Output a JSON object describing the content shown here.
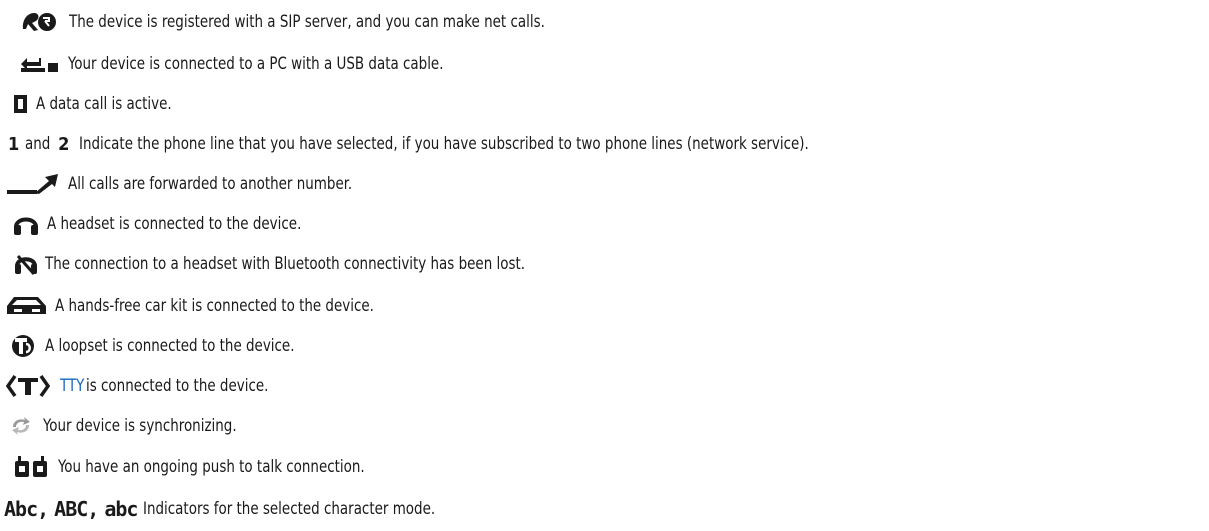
{
  "rows": [
    {
      "id": "sip",
      "icon": "sip-registered-icon",
      "text": "The device is registered with a SIP server, and you can make net calls."
    },
    {
      "id": "usb",
      "icon": "usb-cable-icon",
      "text": "Your device is connected to a PC with a USB data cable."
    },
    {
      "id": "data-call",
      "icon": "data-call-icon",
      "text": "A data call is active."
    },
    {
      "id": "lines",
      "icon": "phone-line-icons",
      "line1": "1",
      "and": "and",
      "line2": "2",
      "text": "Indicate the phone line that you have selected, if you have subscribed to two phone lines (network service)."
    },
    {
      "id": "forward",
      "icon": "call-forward-icon",
      "text": "All calls are forwarded to another number."
    },
    {
      "id": "headset",
      "icon": "headset-icon",
      "text": "A headset is connected to the device."
    },
    {
      "id": "bt-lost",
      "icon": "bluetooth-headset-lost-icon",
      "text": "The connection to a headset with Bluetooth connectivity has been lost."
    },
    {
      "id": "car-kit",
      "icon": "car-kit-icon",
      "text": "A hands-free car kit is connected to the device."
    },
    {
      "id": "loopset",
      "icon": "loopset-icon",
      "text": "A loopset is connected to the device."
    },
    {
      "id": "tty",
      "icon": "tty-icon",
      "link": "TTY",
      "text": "is connected to the device."
    },
    {
      "id": "sync",
      "icon": "sync-icon",
      "text": "Your device is synchronizing."
    },
    {
      "id": "ptt",
      "icon": "push-to-talk-icon",
      "text": "You have an ongoing push to talk connection."
    },
    {
      "id": "char-mode",
      "icon": "character-mode-icons",
      "mode1": "Abc",
      "mode2": "ABC",
      "mode3": "abc",
      "text": "Indicators for the selected character mode."
    }
  ],
  "colors": {
    "text": "#1a1a1a",
    "link": "#1565c0",
    "icon": "#1a1a1a",
    "sync_icon": "#9a9a9a"
  }
}
